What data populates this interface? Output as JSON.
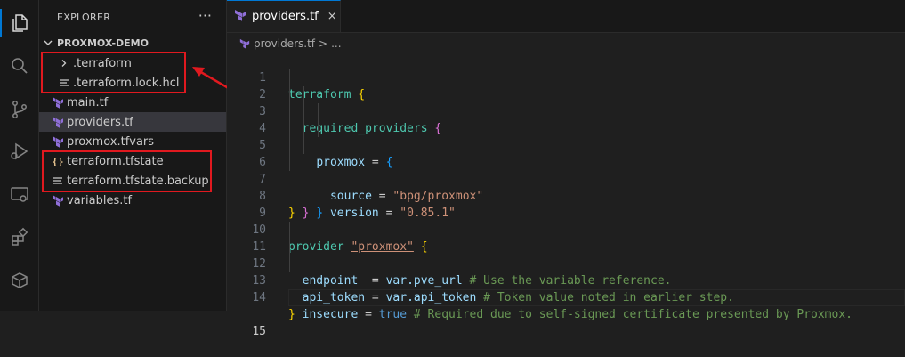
{
  "explorer": {
    "title": "EXPLORER",
    "more": "···",
    "folder": "PROXMOX-DEMO",
    "items": [
      {
        "label": ".terraform",
        "icon": "chevron-right-icon"
      },
      {
        "label": ".terraform.lock.hcl",
        "icon": "lines-file-icon"
      },
      {
        "label": "main.tf",
        "icon": "terraform-icon"
      },
      {
        "label": "providers.tf",
        "icon": "terraform-icon"
      },
      {
        "label": "proxmox.tfvars",
        "icon": "terraform-icon"
      },
      {
        "label": "terraform.tfstate",
        "icon": "json-braces-icon"
      },
      {
        "label": "terraform.tfstate.backup",
        "icon": "lines-file-icon"
      },
      {
        "label": "variables.tf",
        "icon": "terraform-icon"
      }
    ]
  },
  "activity": [
    "files-icon",
    "search-icon",
    "source-control-icon",
    "run-debug-icon",
    "remote-explorer-icon",
    "extensions-icon",
    "package-icon"
  ],
  "tab": {
    "label": "providers.tf",
    "close": "×"
  },
  "breadcrumb": {
    "file": "providers.tf",
    "sep": ">",
    "more": "..."
  },
  "code": {
    "line_numbers": [
      "1",
      "2",
      "3",
      "4",
      "5",
      "6",
      "7",
      "8",
      "9",
      "10",
      "11",
      "12",
      "13",
      "14",
      "15"
    ],
    "l1": {
      "a": "terraform",
      "b": "{"
    },
    "l2": {
      "a": "required_providers",
      "b": "{"
    },
    "l3": {
      "a": "proxmox",
      "op": " = ",
      "b": "{"
    },
    "l4": {
      "a": "source",
      "op": " = ",
      "s": "\"bpg/proxmox\""
    },
    "l5": {
      "a": "version",
      "op": " = ",
      "s": "\"0.85.1\""
    },
    "l6": {
      "b": "}"
    },
    "l7": {
      "b": "}"
    },
    "l8": {
      "b": "}"
    },
    "l10": {
      "kw": "provider",
      "s": "\"proxmox\"",
      "b": "{"
    },
    "l11": {
      "a": "endpoint",
      "op": "  = ",
      "v": "var.pve_url",
      "c": "# Use the variable reference."
    },
    "l12": {
      "a": "api_token",
      "op": " = ",
      "v": "var.api_token",
      "c": "# Token value noted in earlier step."
    },
    "l13": {
      "a": "insecure",
      "op": " = ",
      "kw": "true",
      "c": "# Required due to self-signed certificate presented by Proxmox."
    },
    "l14": {
      "b": "}"
    }
  },
  "colors": {
    "highlight_box": "#e0191f",
    "arrow": "#e0191f",
    "terraform_icon": "#8f6fd8"
  }
}
